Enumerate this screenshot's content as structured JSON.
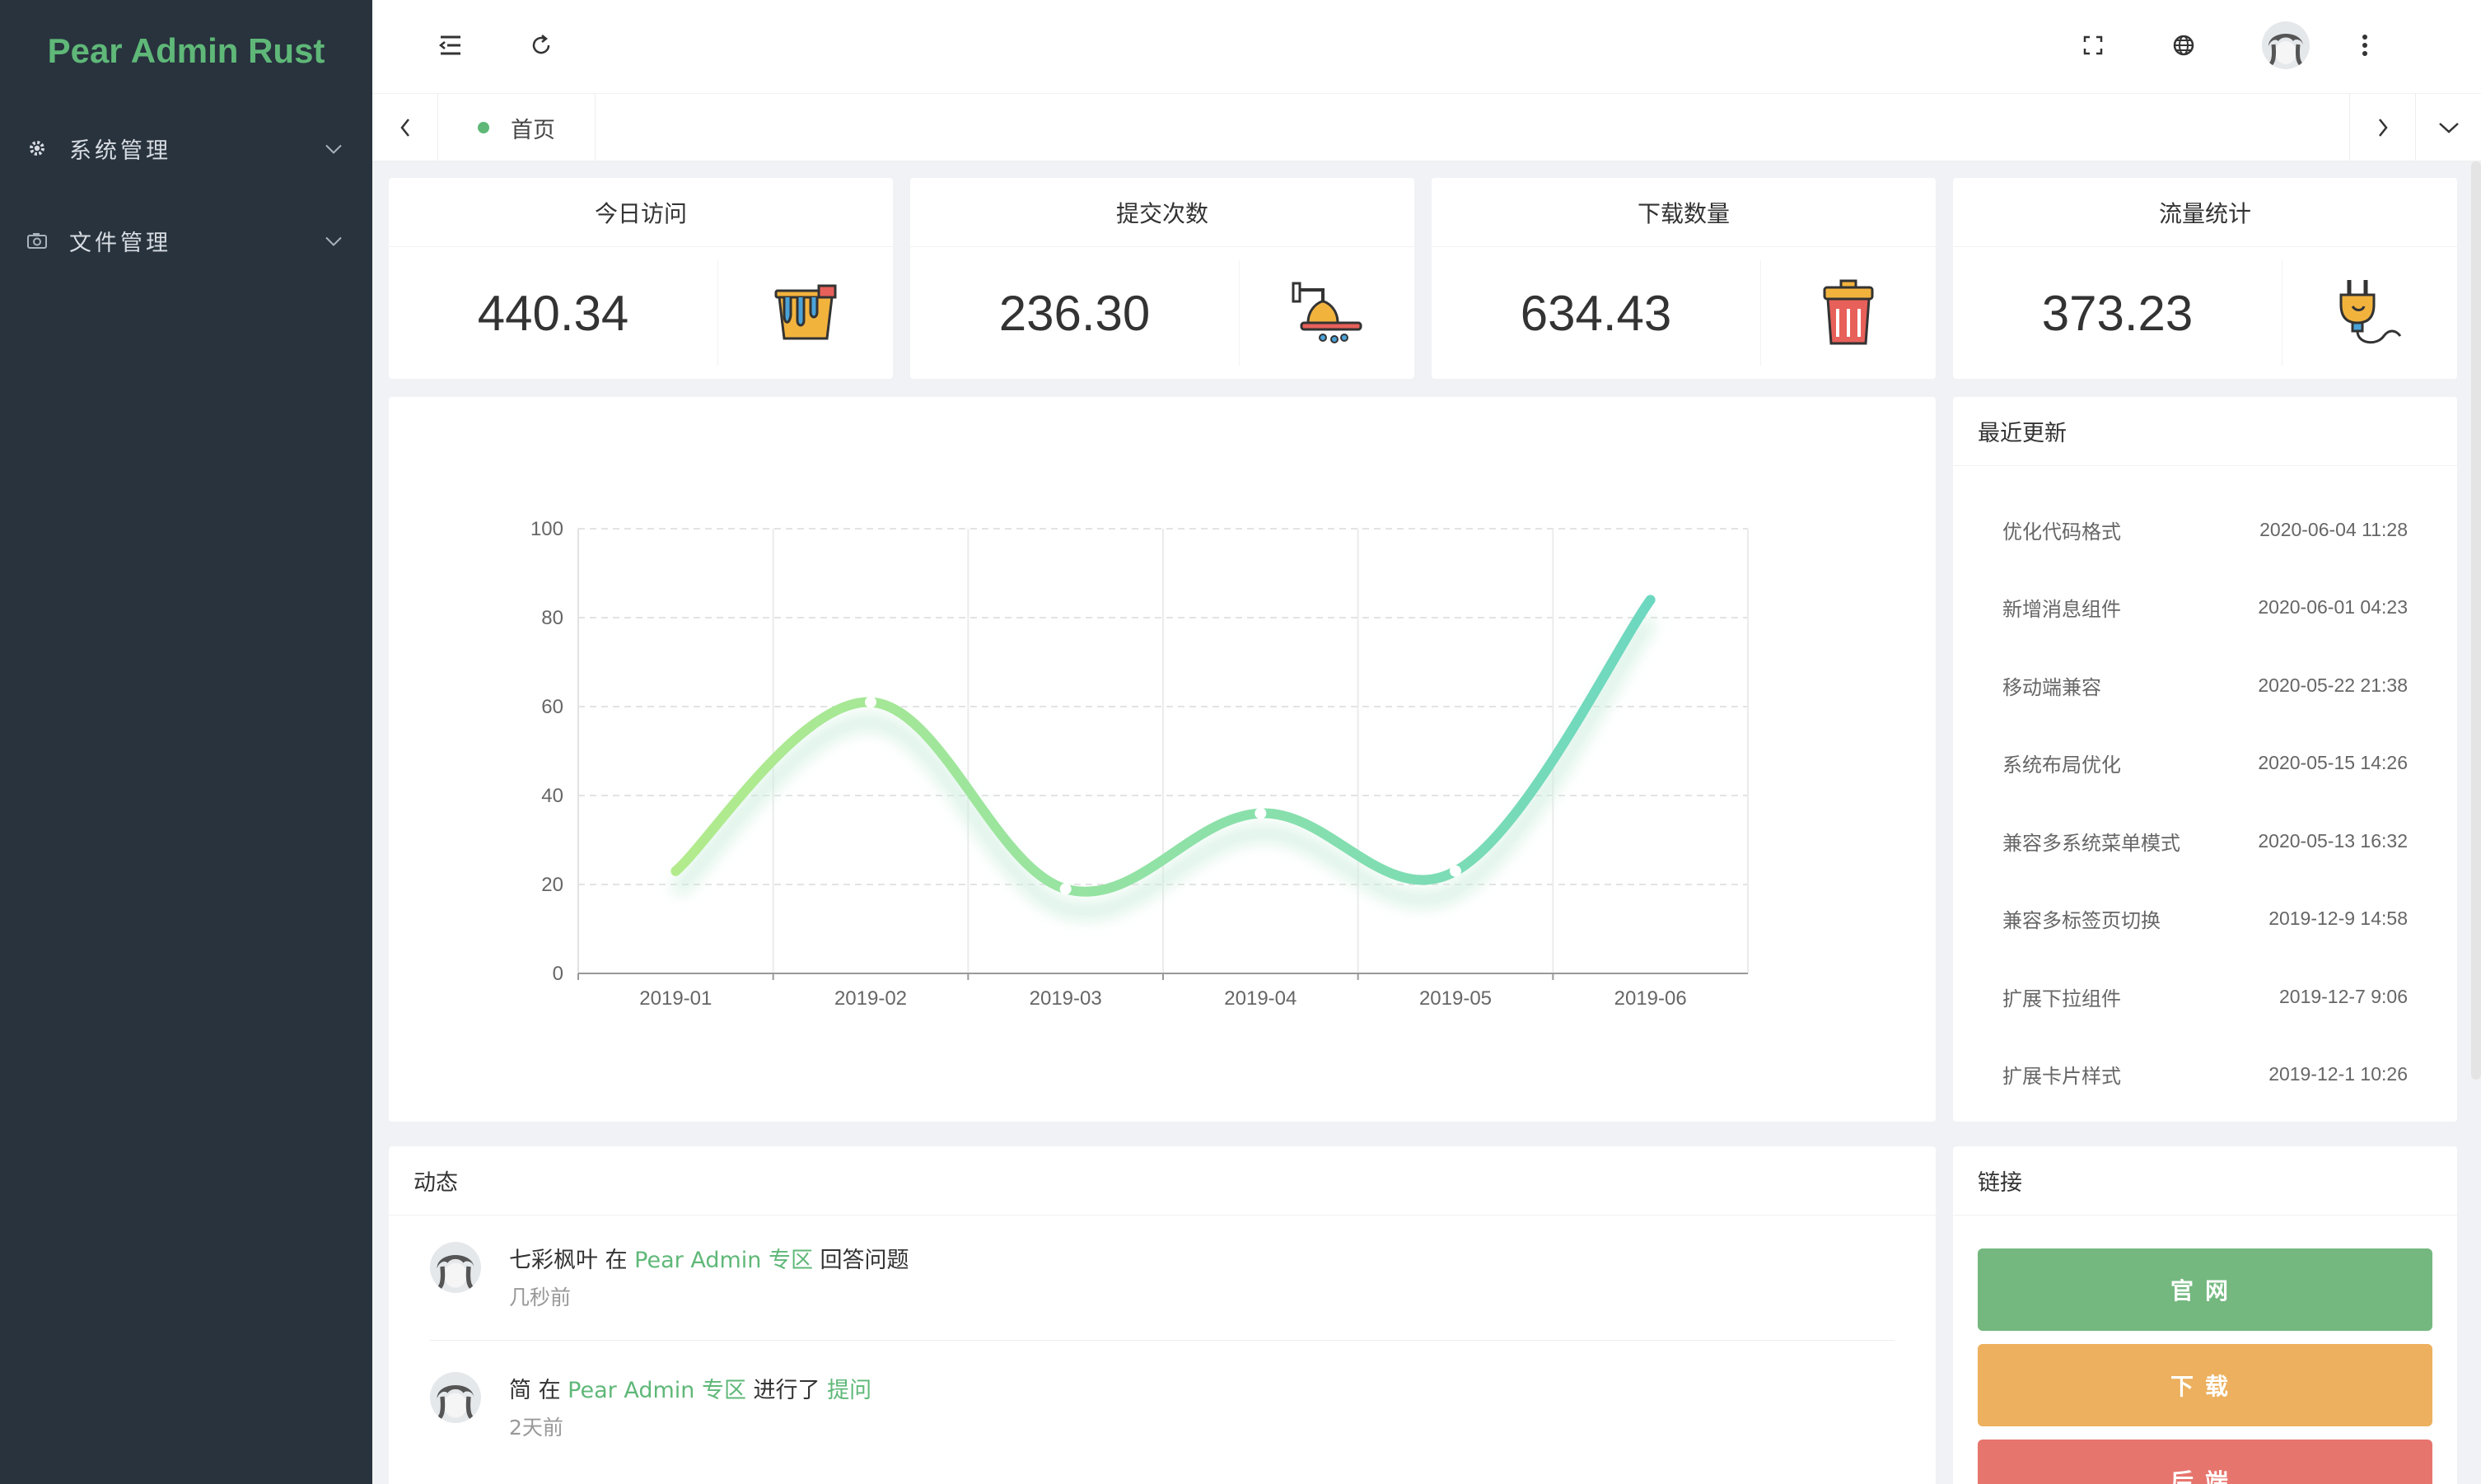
{
  "app": {
    "title": "Pear Admin Rust"
  },
  "sidebar": {
    "items": [
      {
        "label": "系统管理",
        "icon": "gear-icon"
      },
      {
        "label": "文件管理",
        "icon": "camera-icon"
      }
    ]
  },
  "header": {
    "icons": [
      "menu-fold-icon",
      "refresh-icon",
      "fullscreen-icon",
      "globe-icon",
      "more-icon"
    ]
  },
  "tabs": {
    "items": [
      {
        "label": "首页"
      }
    ]
  },
  "stats": [
    {
      "title": "今日访问",
      "value": "440.34",
      "icon": "bucket-icon"
    },
    {
      "title": "提交次数",
      "value": "236.30",
      "icon": "shower-icon"
    },
    {
      "title": "下载数量",
      "value": "634.43",
      "icon": "trash-can-icon"
    },
    {
      "title": "流量统计",
      "value": "373.23",
      "icon": "plug-icon"
    }
  ],
  "chart_data": {
    "type": "line",
    "categories": [
      "2019-01",
      "2019-02",
      "2019-03",
      "2019-04",
      "2019-05",
      "2019-06"
    ],
    "values": [
      23,
      61,
      19,
      36,
      23,
      84
    ],
    "yticks": [
      "0",
      "20",
      "40",
      "60",
      "80",
      "100"
    ],
    "ylim": [
      0,
      100
    ],
    "grid": true,
    "smooth": true,
    "colors": [
      "#b3eb8c",
      "#6dd8c0"
    ]
  },
  "updates": {
    "title": "最近更新",
    "items": [
      {
        "name": "优化代码格式",
        "date": "2020-06-04 11:28"
      },
      {
        "name": "新增消息组件",
        "date": "2020-06-01 04:23"
      },
      {
        "name": "移动端兼容",
        "date": "2020-05-22 21:38"
      },
      {
        "name": "系统布局优化",
        "date": "2020-05-15 14:26"
      },
      {
        "name": "兼容多系统菜单模式",
        "date": "2020-05-13 16:32"
      },
      {
        "name": "兼容多标签页切换",
        "date": "2019-12-9 14:58"
      },
      {
        "name": "扩展下拉组件",
        "date": "2019-12-7 9:06"
      },
      {
        "name": "扩展卡片样式",
        "date": "2019-12-1 10:26"
      }
    ]
  },
  "activity": {
    "title": "动态",
    "items": [
      {
        "user": "七彩枫叶",
        "in": " 在 ",
        "place": "Pear Admin 专区",
        "action": " 回答问题",
        "target": "",
        "time": "几秒前"
      },
      {
        "user": "简",
        "in": " 在 ",
        "place": "Pear Admin 专区",
        "action": " 进行了 ",
        "target": "提问",
        "time": "2天前"
      }
    ]
  },
  "links": {
    "title": "链接",
    "items": [
      {
        "label": "官网",
        "color": "#74b87f"
      },
      {
        "label": "下载",
        "color": "#ecb05e"
      },
      {
        "label": "后端",
        "color": "#e6756e"
      }
    ]
  }
}
